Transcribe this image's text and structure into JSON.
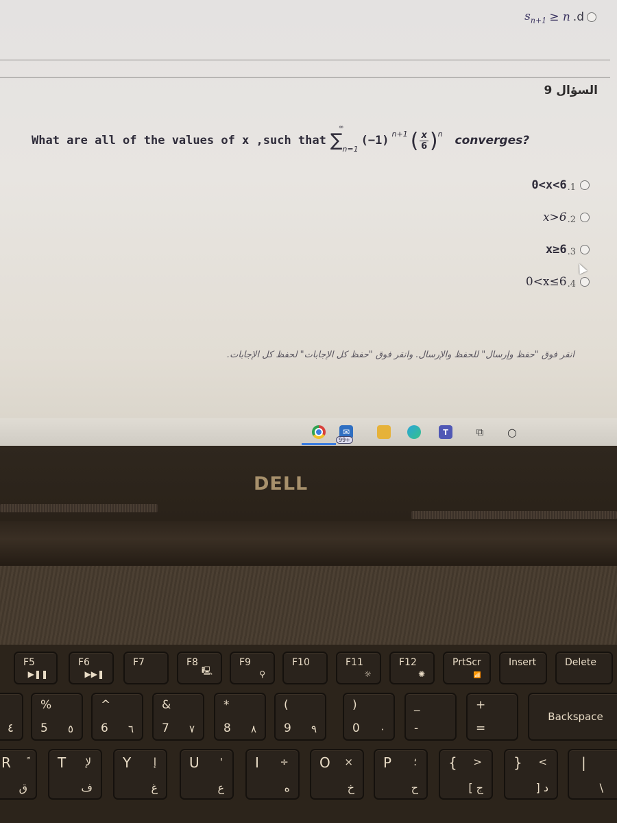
{
  "screen": {
    "previous_option": {
      "math": "s",
      "math_sub": "n+1",
      "rest": "≥ n",
      "number": ".d"
    },
    "question_title": "السؤال 9",
    "question": {
      "prefix": "What are all of the values of x ,such that",
      "sigma_top": "∞",
      "sigma_bottom": "n=1",
      "base": "(−1)",
      "base_exp": "n+1",
      "frac_num": "x",
      "frac_den": "6",
      "outer_exp": "n",
      "suffix": "converges?"
    },
    "options": [
      {
        "number": ".1",
        "label": "0<x<6",
        "selected": false
      },
      {
        "number": ".2",
        "label": "x>6",
        "selected": false
      },
      {
        "number": ".3",
        "label": "x≥6",
        "selected": false
      },
      {
        "number": ".4",
        "label": "0<x≤6",
        "selected": false
      }
    ],
    "instructions": "انقر فوق \"حفظ وإرسال\" للحفظ والإرسال. وانقر فوق \"حفظ كل الإجابات\" لحفظ كل الإجابات."
  },
  "taskbar": {
    "apps": [
      {
        "name": "Chrome",
        "icon": "chrome-icon"
      },
      {
        "name": "Mail",
        "icon": "mail-icon",
        "badge": "99+"
      },
      {
        "name": "File Explorer",
        "icon": "folder-icon"
      },
      {
        "name": "Edge",
        "icon": "edge-icon"
      },
      {
        "name": "Teams",
        "icon": "teams-icon",
        "glyph": "T"
      },
      {
        "name": "Task View",
        "icon": "task-view-icon",
        "glyph": "⧉"
      },
      {
        "name": "Search",
        "icon": "search-icon",
        "glyph": "○"
      }
    ]
  },
  "laptop": {
    "brand": "DELL"
  },
  "keyboard": {
    "fn_row": [
      {
        "label": "F5",
        "sub": "▶❚❚"
      },
      {
        "label": "F6",
        "sub": "▶▶❚"
      },
      {
        "label": "F7",
        "sub": ""
      },
      {
        "label": "F8",
        "sub": "🖳"
      },
      {
        "label": "F9",
        "sub": "⚲"
      },
      {
        "label": "F10",
        "sub": ""
      },
      {
        "label": "F11",
        "sub": "☼"
      },
      {
        "label": "F12",
        "sub": "✺"
      },
      {
        "label": "PrtScr",
        "sub": "📶"
      },
      {
        "label": "Insert",
        "sub": ""
      },
      {
        "label": "Delete",
        "sub": ""
      }
    ],
    "num_row": [
      {
        "top": "",
        "bottom": "",
        "arabic": "٤"
      },
      {
        "top": "%",
        "bottom": "5",
        "arabic": "٥"
      },
      {
        "top": "^",
        "bottom": "6",
        "arabic": "٦"
      },
      {
        "top": "&",
        "bottom": "7",
        "arabic": "٧"
      },
      {
        "top": "*",
        "bottom": "8",
        "arabic": "٨"
      },
      {
        "top": "(",
        "bottom": "9",
        "arabic": "٩"
      },
      {
        "top": ")",
        "bottom": "0",
        "arabic": "٠"
      },
      {
        "top": "_",
        "bottom": "-",
        "arabic": ""
      },
      {
        "top": "+",
        "bottom": "=",
        "arabic": ""
      },
      {
        "label": "Backspace"
      }
    ],
    "letter_row": [
      {
        "letter": "R",
        "alt": "ً",
        "arabic": "ق"
      },
      {
        "letter": "T",
        "alt": "لإ",
        "arabic": "ف"
      },
      {
        "letter": "Y",
        "alt": "إ",
        "arabic": "غ"
      },
      {
        "letter": "U",
        "alt": "'",
        "arabic": "ع"
      },
      {
        "letter": "I",
        "alt": "÷",
        "arabic": "ه"
      },
      {
        "letter": "O",
        "alt": "×",
        "arabic": "خ"
      },
      {
        "letter": "P",
        "alt": "؛",
        "arabic": "ح"
      },
      {
        "letter": "{",
        "alt": ">",
        "arabic": "[ ج"
      },
      {
        "letter": "}",
        "alt": "<",
        "arabic": "] د"
      },
      {
        "letter": "|",
        "alt": "",
        "arabic": "\\"
      }
    ]
  }
}
